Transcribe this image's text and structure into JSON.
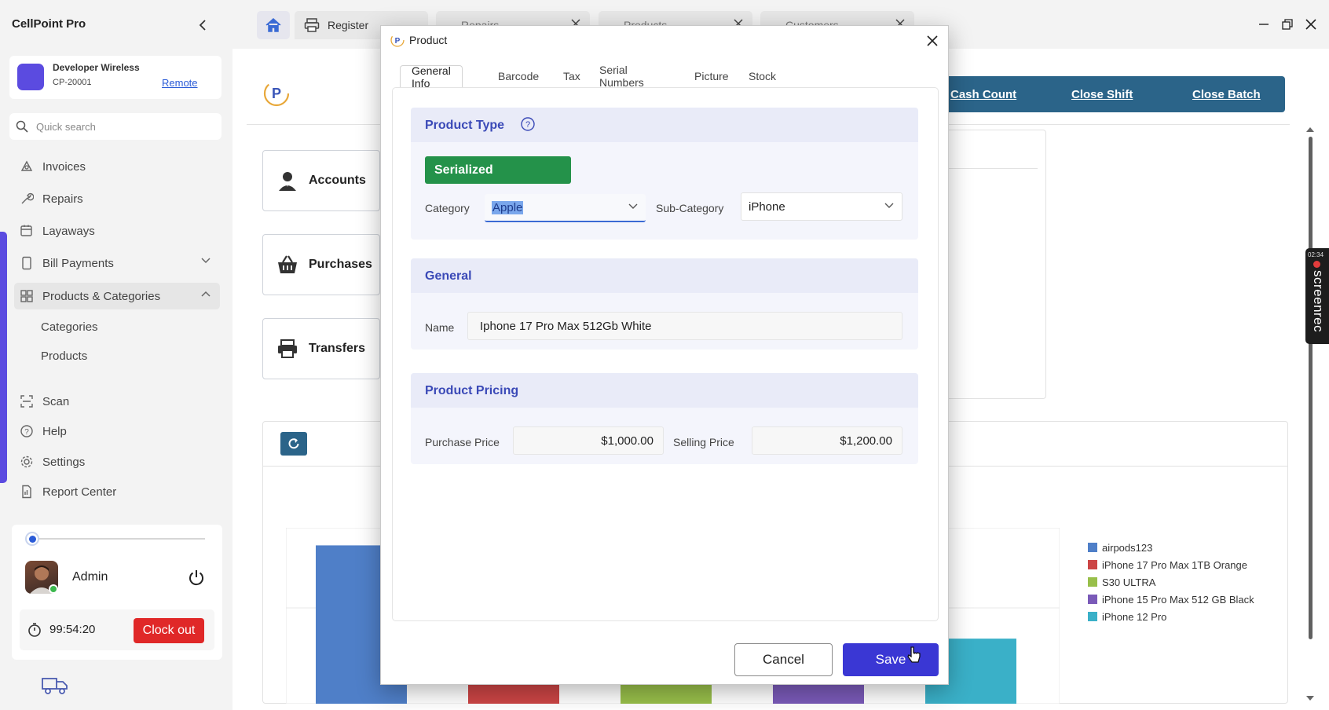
{
  "app": {
    "title": "CellPoint Pro"
  },
  "store": {
    "name": "Developer Wireless",
    "code": "CP-20001",
    "mode": "Remote"
  },
  "search": {
    "placeholder": "Quick search"
  },
  "nav": {
    "invoices": "Invoices",
    "repairs": "Repairs",
    "layaways": "Layaways",
    "bill_payments": "Bill Payments",
    "products_categories": "Products & Categories",
    "sub_categories": "Categories",
    "sub_products": "Products",
    "scan": "Scan",
    "help": "Help",
    "settings": "Settings",
    "report_center": "Report Center"
  },
  "user": {
    "name": "Admin",
    "timer": "99:54:20",
    "clock_out": "Clock out"
  },
  "tabs": {
    "register": "Register",
    "repairs": "Repairs",
    "products": "Products",
    "customers": "Customers"
  },
  "actions": {
    "cash_count": "Cash Count",
    "close_shift": "Close Shift",
    "close_batch": "Close Batch"
  },
  "tiles": {
    "accounts": "Accounts",
    "purchases": "Purchases",
    "transfers": "Transfers"
  },
  "chart_data": {
    "type": "bar",
    "series": [
      {
        "name": "airpods123",
        "color": "#4f7fc8"
      },
      {
        "name": "iPhone 17 Pro Max 1TB Orange",
        "color": "#cc4545"
      },
      {
        "name": "S30 ULTRA",
        "color": "#98bf4a"
      },
      {
        "name": "iPhone 15 Pro Max 512 GB Black",
        "color": "#7a5ab8"
      },
      {
        "name": "iPhone 12 Pro",
        "color": "#3ab0c8"
      }
    ],
    "relative_values": [
      0.9,
      0.12,
      0.12,
      0.12,
      0.37
    ],
    "legend": "right"
  },
  "modal": {
    "title": "Product",
    "tabs": [
      "General Info",
      "Barcode",
      "Tax",
      "Serial Numbers",
      "Picture",
      "Stock"
    ],
    "product_type": {
      "title": "Product Type",
      "type_button": "Serialized"
    },
    "category": {
      "label": "Category",
      "value": "Apple"
    },
    "subcategory": {
      "label": "Sub-Category",
      "value": "iPhone"
    },
    "general": {
      "title": "General",
      "name_label": "Name",
      "name_value": "Iphone 17 Pro Max 512Gb White"
    },
    "pricing": {
      "title": "Product Pricing",
      "purchase_label": "Purchase Price",
      "purchase_value": "$1,000.00",
      "selling_label": "Selling Price",
      "selling_value": "$1,200.00"
    },
    "cancel": "Cancel",
    "save": "Save"
  },
  "recorder": {
    "time": "02:34",
    "label": "screenrec"
  }
}
